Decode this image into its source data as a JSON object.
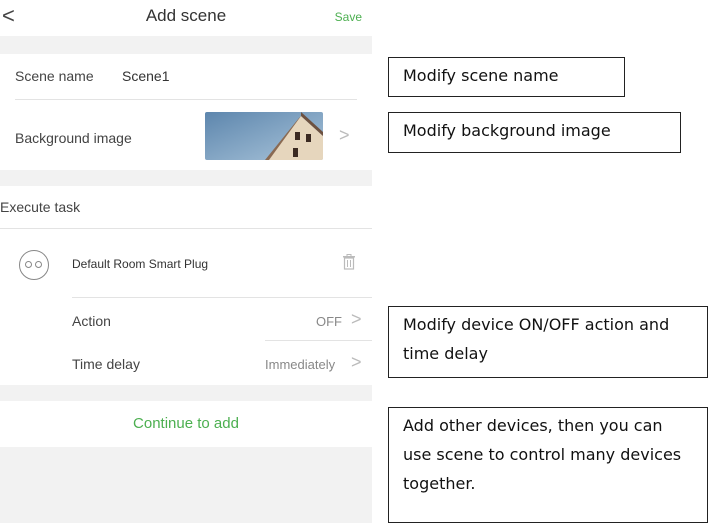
{
  "header": {
    "back_glyph": "<",
    "title": "Add scene",
    "save_label": "Save"
  },
  "scene": {
    "name_label": "Scene name",
    "name_value": "Scene1",
    "background_label": "Background image"
  },
  "execute": {
    "section_label": "Execute task",
    "device_name": "Default Room Smart Plug"
  },
  "action": {
    "label": "Action",
    "value": "OFF"
  },
  "delay": {
    "label": "Time delay",
    "value": "Immediately"
  },
  "continue_label": "Continue to add",
  "chevron": ">",
  "callouts": {
    "name": "Modify scene name",
    "background": "Modify background image",
    "device": "Modify device ON/OFF action and time delay",
    "add": "Add other devices, then you can use scene to control many devices together."
  },
  "icons": [
    "back-chevron-icon",
    "chevron-right-icon",
    "trash-icon",
    "smart-plug-icon"
  ],
  "colors": {
    "accent": "#4CAF50",
    "separator": "#f2f2f2"
  }
}
